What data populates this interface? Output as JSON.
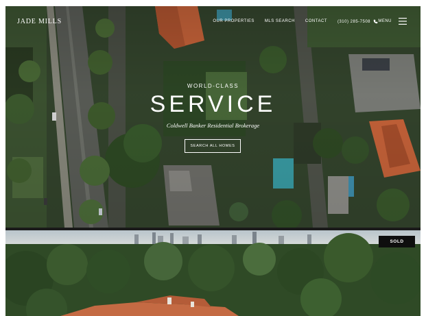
{
  "nav": {
    "logo": "JADE MILLS",
    "links": [
      "OUR PROPERTIES",
      "MLS SEARCH",
      "CONTACT"
    ],
    "phone": "(310) 285-7508",
    "phone_icon": "phone-icon",
    "menu_label": "MENU",
    "menu_icon": "hamburger-icon"
  },
  "hero": {
    "eyebrow": "WORLD-CLASS",
    "headline": "SERVICE",
    "subline": "Coldwell Banker Residential Brokerage",
    "cta_label": "SEARCH ALL HOMES"
  },
  "listing": {
    "badge": "SOLD"
  },
  "colors": {
    "text": "#ffffff",
    "badge_bg": "#0e0e0e",
    "foliage": "#2f4a26",
    "roof": "#c9643a"
  }
}
